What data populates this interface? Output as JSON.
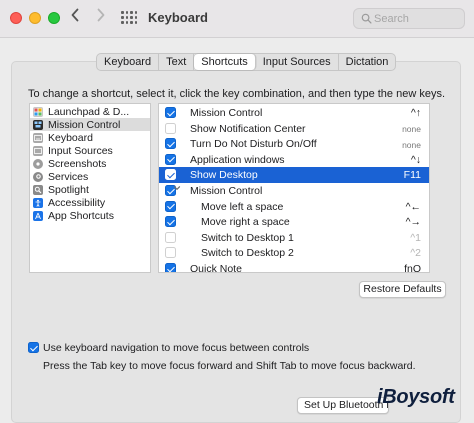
{
  "window": {
    "title": "Keyboard"
  },
  "search": {
    "placeholder": "Search"
  },
  "tabs": [
    {
      "label": "Keyboard",
      "active": false
    },
    {
      "label": "Text",
      "active": false
    },
    {
      "label": "Shortcuts",
      "active": true
    },
    {
      "label": "Input Sources",
      "active": false
    },
    {
      "label": "Dictation",
      "active": false
    }
  ],
  "instructions": "To change a shortcut, select it, click the key combination, and then type the new keys.",
  "categories": [
    {
      "label": "Launchpad & D...",
      "icon": "launchpad-icon",
      "color": "#e8e8e8"
    },
    {
      "label": "Mission Control",
      "icon": "mission-control-icon",
      "color": "#2b2b2b",
      "selected": true
    },
    {
      "label": "Keyboard",
      "icon": "keyboard-icon",
      "color": "#9a9a9a"
    },
    {
      "label": "Input Sources",
      "icon": "input-sources-icon",
      "color": "#9a9a9a"
    },
    {
      "label": "Screenshots",
      "icon": "screenshots-icon",
      "color": "#a0a0a0"
    },
    {
      "label": "Services",
      "icon": "gear-icon",
      "color": "#8a8a8a"
    },
    {
      "label": "Spotlight",
      "icon": "spotlight-icon",
      "color": "#8a8a8a"
    },
    {
      "label": "Accessibility",
      "icon": "accessibility-icon",
      "color": "#1a73e8"
    },
    {
      "label": "App Shortcuts",
      "icon": "app-shortcuts-icon",
      "color": "#1a73e8"
    }
  ],
  "shortcuts": [
    {
      "label": "Mission Control",
      "key": "^↑",
      "checked": true
    },
    {
      "label": "Show Notification Center",
      "key": "none",
      "checked": false
    },
    {
      "label": "Turn Do Not Disturb On/Off",
      "key": "none",
      "checked": true
    },
    {
      "label": "Application windows",
      "key": "^↓",
      "checked": true
    },
    {
      "label": "Show Desktop",
      "key": "F11",
      "checked": true,
      "selected": true
    },
    {
      "label": "Mission Control",
      "key": "",
      "checked": true,
      "group": true
    },
    {
      "label": "Move left a space",
      "key": "^←",
      "checked": true,
      "indent": true
    },
    {
      "label": "Move right a space",
      "key": "^→",
      "checked": true,
      "indent": true
    },
    {
      "label": "Switch to Desktop 1",
      "key": "^1",
      "checked": false,
      "indent": true,
      "dim": true
    },
    {
      "label": "Switch to Desktop 2",
      "key": "^2",
      "checked": false,
      "indent": true,
      "dim": true
    },
    {
      "label": "Quick Note",
      "key": "fnQ",
      "checked": true
    }
  ],
  "restore_button": "Restore Defaults",
  "keyboard_navigation": {
    "label": "Use keyboard navigation to move focus between controls",
    "checked": true,
    "help": "Press the Tab key to move focus forward and Shift Tab to move focus backward."
  },
  "bluetooth_button": "Set Up Bluetooth Keyboard...",
  "watermark": "iBoysoft",
  "colors": {
    "accent": "#1573e6",
    "selection": "#1a62d4"
  }
}
